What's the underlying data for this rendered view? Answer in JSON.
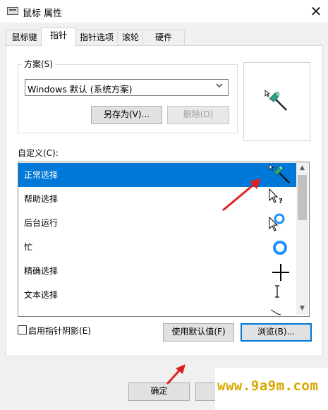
{
  "window": {
    "title": "鼠标 属性"
  },
  "tabs": [
    {
      "label": "鼠标键"
    },
    {
      "label": "指针"
    },
    {
      "label": "指针选项"
    },
    {
      "label": "滚轮"
    },
    {
      "label": "硬件"
    }
  ],
  "scheme": {
    "group_label": "方案(S)",
    "selected": "Windows 默认 (系统方案)",
    "save_as": "另存为(V)...",
    "delete": "删除(D)"
  },
  "custom": {
    "label": "自定义(C):",
    "items": [
      {
        "label": "正常选择",
        "icon": "normal-select-cursor-icon"
      },
      {
        "label": "帮助选择",
        "icon": "help-select-cursor-icon"
      },
      {
        "label": "后台运行",
        "icon": "working-in-background-cursor-icon"
      },
      {
        "label": "忙",
        "icon": "busy-cursor-icon"
      },
      {
        "label": "精确选择",
        "icon": "precision-select-cursor-icon"
      },
      {
        "label": "文本选择",
        "icon": "text-select-cursor-icon"
      }
    ]
  },
  "shadow_checkbox": {
    "label": "启用指针阴影(E)",
    "checked": false
  },
  "buttons": {
    "use_default": "使用默认值(F)",
    "browse": "浏览(B)...",
    "ok": "确定"
  },
  "watermark": "www.9a9m.com",
  "colors": {
    "accent": "#0078d7",
    "arrow": "#e02020",
    "watermark": "#d9a800",
    "cursor_green": "#2aa089"
  }
}
